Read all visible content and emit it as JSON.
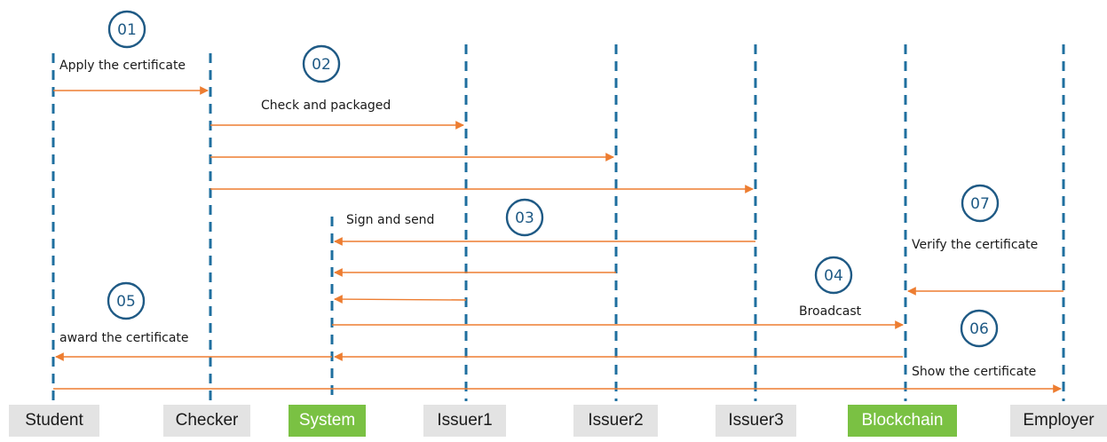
{
  "colors": {
    "lifeline": "#1f6f9f",
    "arrow": "#ed7d31",
    "step_circle": "#1f5a85",
    "actor_box": "#e3e3e3",
    "actor_box_highlight": "#7ac143"
  },
  "actors": [
    {
      "id": "student",
      "label": "Student",
      "highlight": false
    },
    {
      "id": "checker",
      "label": "Checker",
      "highlight": false
    },
    {
      "id": "system",
      "label": "System",
      "highlight": true
    },
    {
      "id": "issuer1",
      "label": "Issuer1",
      "highlight": false
    },
    {
      "id": "issuer2",
      "label": "Issuer2",
      "highlight": false
    },
    {
      "id": "issuer3",
      "label": "Issuer3",
      "highlight": false
    },
    {
      "id": "blockchain",
      "label": "Blockchain",
      "highlight": true
    },
    {
      "id": "employer",
      "label": "Employer",
      "highlight": false
    }
  ],
  "messages": [
    {
      "from": "student",
      "to": "checker",
      "label": "Apply the certificate",
      "step": "01"
    },
    {
      "from": "checker",
      "to": "issuer1",
      "label": "Check and packaged",
      "step": "02"
    },
    {
      "from": "checker",
      "to": "issuer2",
      "label": "",
      "step": ""
    },
    {
      "from": "checker",
      "to": "issuer3",
      "label": "",
      "step": ""
    },
    {
      "from": "issuer3",
      "to": "system",
      "label": "Sign and send",
      "step": "03"
    },
    {
      "from": "issuer2",
      "to": "system",
      "label": "",
      "step": ""
    },
    {
      "from": "issuer1",
      "to": "system",
      "label": "",
      "step": ""
    },
    {
      "from": "system",
      "to": "blockchain",
      "label": "Broadcast",
      "step": "04"
    },
    {
      "from": "employer",
      "to": "blockchain",
      "label": "Verify the certificate",
      "step": "07"
    },
    {
      "from": "blockchain",
      "to": "system",
      "label": "",
      "step": ""
    },
    {
      "from": "system",
      "to": "student",
      "label": "award the certificate",
      "step": "05"
    },
    {
      "from": "student",
      "to": "employer",
      "label": "Show the certificate",
      "step": "06"
    }
  ]
}
